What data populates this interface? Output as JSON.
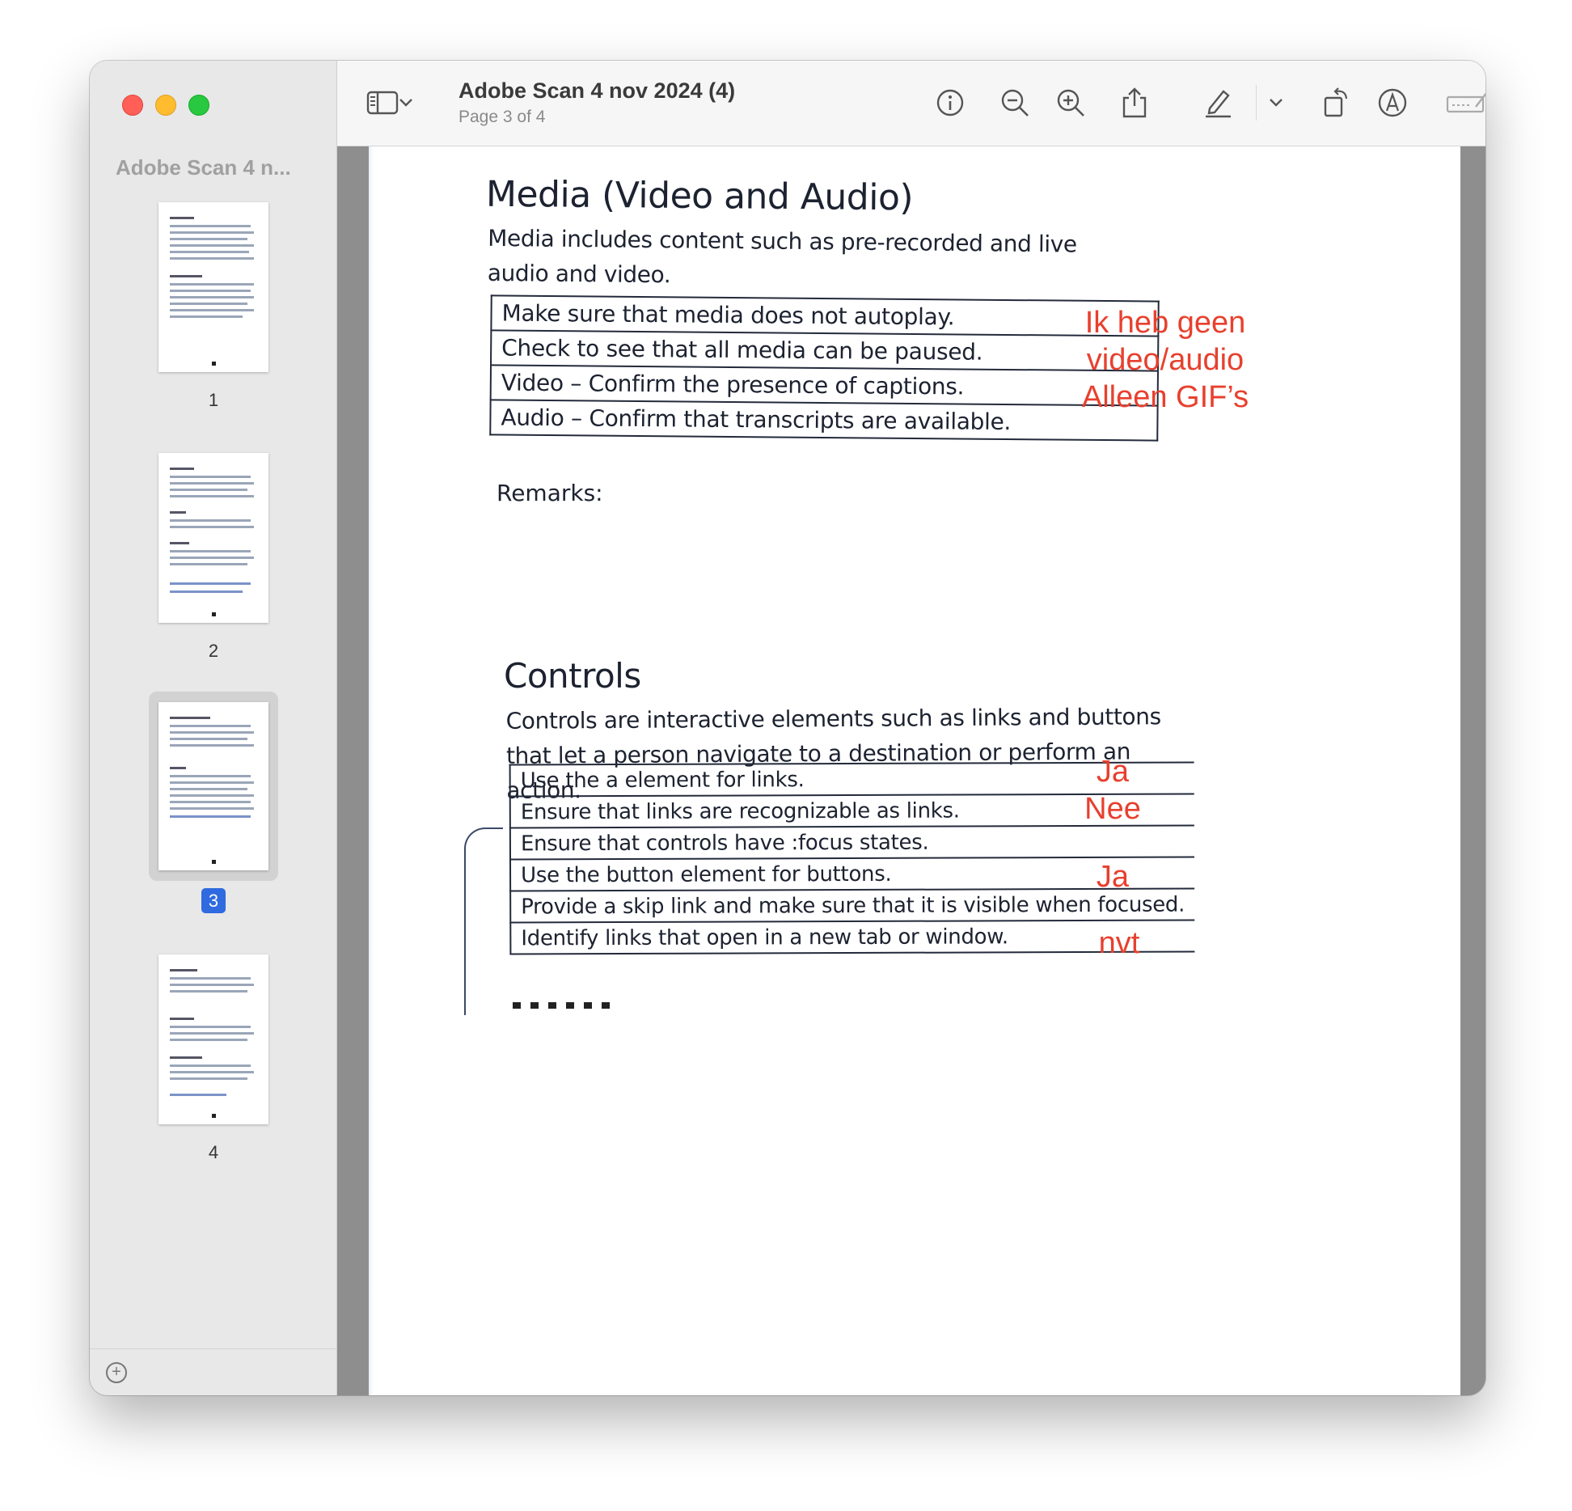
{
  "window": {
    "sidebar_title": "Adobe Scan 4 n...",
    "doc_title": "Adobe Scan 4 nov 2024 (4)",
    "doc_subtitle": "Page 3 of 4"
  },
  "toolbar": {
    "icons": [
      "sidebar-toggle-icon",
      "chevron-down-icon",
      "info-icon",
      "zoom-out-icon",
      "zoom-in-icon",
      "share-icon",
      "highlight-pen-icon",
      "chevron-down-icon",
      "rotate-icon",
      "markup-icon",
      "form-fill-icon",
      "search-icon"
    ]
  },
  "thumbnails": [
    {
      "label": "1",
      "selected": false
    },
    {
      "label": "2",
      "selected": false
    },
    {
      "label": "3",
      "selected": true
    },
    {
      "label": "4",
      "selected": false
    }
  ],
  "page": {
    "media_heading": "Media (Video and Audio)",
    "media_intro": "Media includes content such as pre-recorded and live audio and video.",
    "media_items": [
      "Make sure that media does not autoplay.",
      "Check to see that all media can be paused.",
      "Video – Confirm the presence of captions.",
      "Audio – Confirm that transcripts are available."
    ],
    "remarks_label": "Remarks:",
    "controls_heading": "Controls",
    "controls_intro": "Controls are interactive elements such as links and buttons that let a person navigate to a destination or perform an action.",
    "controls_items": [
      "Use the a element for links.",
      "Ensure that links are recognizable as links.",
      "Ensure that controls have :focus states.",
      "Use the button element for buttons.",
      "Provide a skip link and make sure that it is visible when focused.",
      "Identify links that open in a new tab or window."
    ]
  },
  "annotations": {
    "media_note_line1": "Ik heb geen",
    "media_note_line2": "video/audio",
    "media_note_line3": "Alleen GIF’s",
    "ctrl_note_1": "Ja",
    "ctrl_note_2": "Nee",
    "ctrl_note_4": "Ja",
    "ctrl_note_6": "nvt",
    "color": "#e8402e"
  },
  "colors": {
    "accent": "#2f6ae0",
    "traffic_red": "#ff5f57",
    "traffic_yellow": "#febc2e",
    "traffic_green": "#28c840"
  }
}
